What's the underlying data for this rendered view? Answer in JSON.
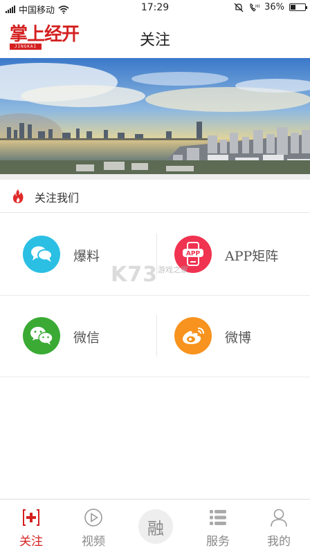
{
  "status_bar": {
    "carrier": "中国移动",
    "time": "17:29",
    "battery": "36%",
    "battery_level": 0.36
  },
  "header": {
    "logo_text": "掌上经开",
    "logo_subtext": "JINGKAI",
    "title": "关注"
  },
  "section": {
    "title": "关注我们"
  },
  "grid": {
    "items": [
      {
        "label": "爆料",
        "icon": "speech-bubbles-icon",
        "color": "#2bbfe4"
      },
      {
        "label": "APP矩阵",
        "icon": "phone-app-icon",
        "color": "#f03350"
      },
      {
        "label": "微信",
        "icon": "wechat-icon",
        "color": "#3aaa35"
      },
      {
        "label": "微博",
        "icon": "weibo-icon",
        "color": "#f7931e"
      }
    ],
    "app_badge": "APP"
  },
  "watermark": {
    "main": "K73",
    "sub": "游戏之家"
  },
  "bottom_nav": {
    "items": [
      {
        "label": "关注",
        "icon": "follow-icon",
        "active": true
      },
      {
        "label": "视频",
        "icon": "play-icon",
        "active": false
      },
      {
        "label": "服务",
        "icon": "list-icon",
        "active": false
      },
      {
        "label": "我的",
        "icon": "user-icon",
        "active": false
      }
    ],
    "center_label": "融"
  },
  "colors": {
    "accent": "#d42020"
  }
}
